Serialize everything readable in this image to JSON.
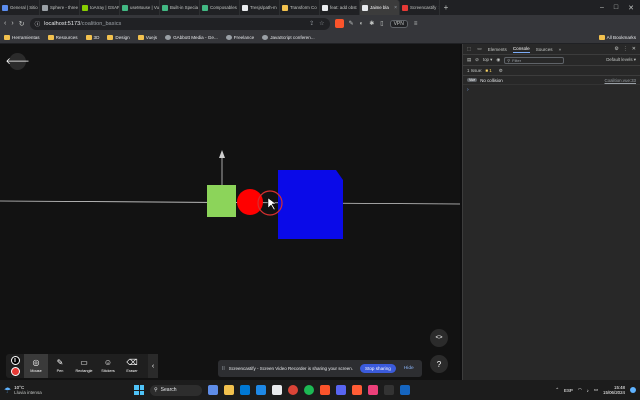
{
  "browser": {
    "tabs": [
      {
        "label": "General | Sitio",
        "color": "#5b8def"
      },
      {
        "label": "Sphere - three",
        "color": "#9aa0a6"
      },
      {
        "label": "toArray | GSAP",
        "color": "#88ce02"
      },
      {
        "label": "useMouse | Vu",
        "color": "#42b883"
      },
      {
        "label": "Built-in Specia",
        "color": "#42b883"
      },
      {
        "label": "Composables",
        "color": "#42b883"
      },
      {
        "label": "Tresjs/path-m",
        "color": "#e8eaed"
      },
      {
        "label": "Transform Co",
        "color": "#f2c14e"
      },
      {
        "label": "feat: add obst",
        "color": "#e8eaed"
      },
      {
        "label": "Jaime bla",
        "color": "#e8eaed",
        "active": true
      },
      {
        "label": "Screencastify",
        "color": "#e53935"
      }
    ],
    "new_tab_label": "+",
    "window_controls": [
      "–",
      "□",
      "✕"
    ],
    "address": {
      "host": "localhost:5173",
      "path": "/coalition_basics"
    },
    "extensions": {
      "vpn_label": "VPN"
    },
    "bookmarks": [
      {
        "label": "Herramientas",
        "type": "folder"
      },
      {
        "label": "Resources",
        "type": "folder"
      },
      {
        "label": "3D",
        "type": "folder"
      },
      {
        "label": "Design",
        "type": "folder"
      },
      {
        "label": "Vuejs",
        "type": "folder"
      },
      {
        "label": "GAbbott Media - Ge...",
        "type": "link"
      },
      {
        "label": "Freelance",
        "type": "link"
      },
      {
        "label": "JavaScript conferen...",
        "type": "link"
      }
    ],
    "all_bookmarks_label": "All Bookmarks"
  },
  "scene": {
    "colors": {
      "green_box": "#8cd45a",
      "red_sphere": "#ff0000",
      "blue_box": "#0a0ae8",
      "axis": "#cfcfcf",
      "background": "#121212"
    }
  },
  "overlay": {
    "code_button_label": "<>",
    "help_button_label": "?"
  },
  "screencastify": {
    "tools": [
      {
        "label": "Mouse",
        "icon": "◎",
        "active": true
      },
      {
        "label": "Pen",
        "icon": "✎"
      },
      {
        "label": "Rectangle",
        "icon": "▭"
      },
      {
        "label": "Stickers",
        "icon": "☺"
      },
      {
        "label": "Eraser",
        "icon": "⌫"
      }
    ],
    "pause_label": "II",
    "collapse_label": "‹"
  },
  "share_bar": {
    "pause_icon": "II",
    "message": "Screencastify - Screen Video Recorder is sharing your screen.",
    "stop_label": "Stop sharing",
    "hide_label": "Hide"
  },
  "devtools": {
    "tabs": [
      "Elements",
      "Console",
      "Sources"
    ],
    "active_tab": "Console",
    "more_label": "»",
    "context": "top",
    "filter_placeholder": "Filter",
    "levels_label": "Default levels",
    "issues_text": "1 Issue:",
    "issues_count": "1",
    "log": {
      "badge": "Vue",
      "message": "No collision",
      "source": "Coalition.vue:33"
    },
    "prompt": "›"
  },
  "taskbar": {
    "weather": {
      "temp": "10°C",
      "condition": "Lluvia intensa"
    },
    "search_label": "Search",
    "language": "ESP",
    "time": "15:48",
    "date": "15/06/2024"
  }
}
